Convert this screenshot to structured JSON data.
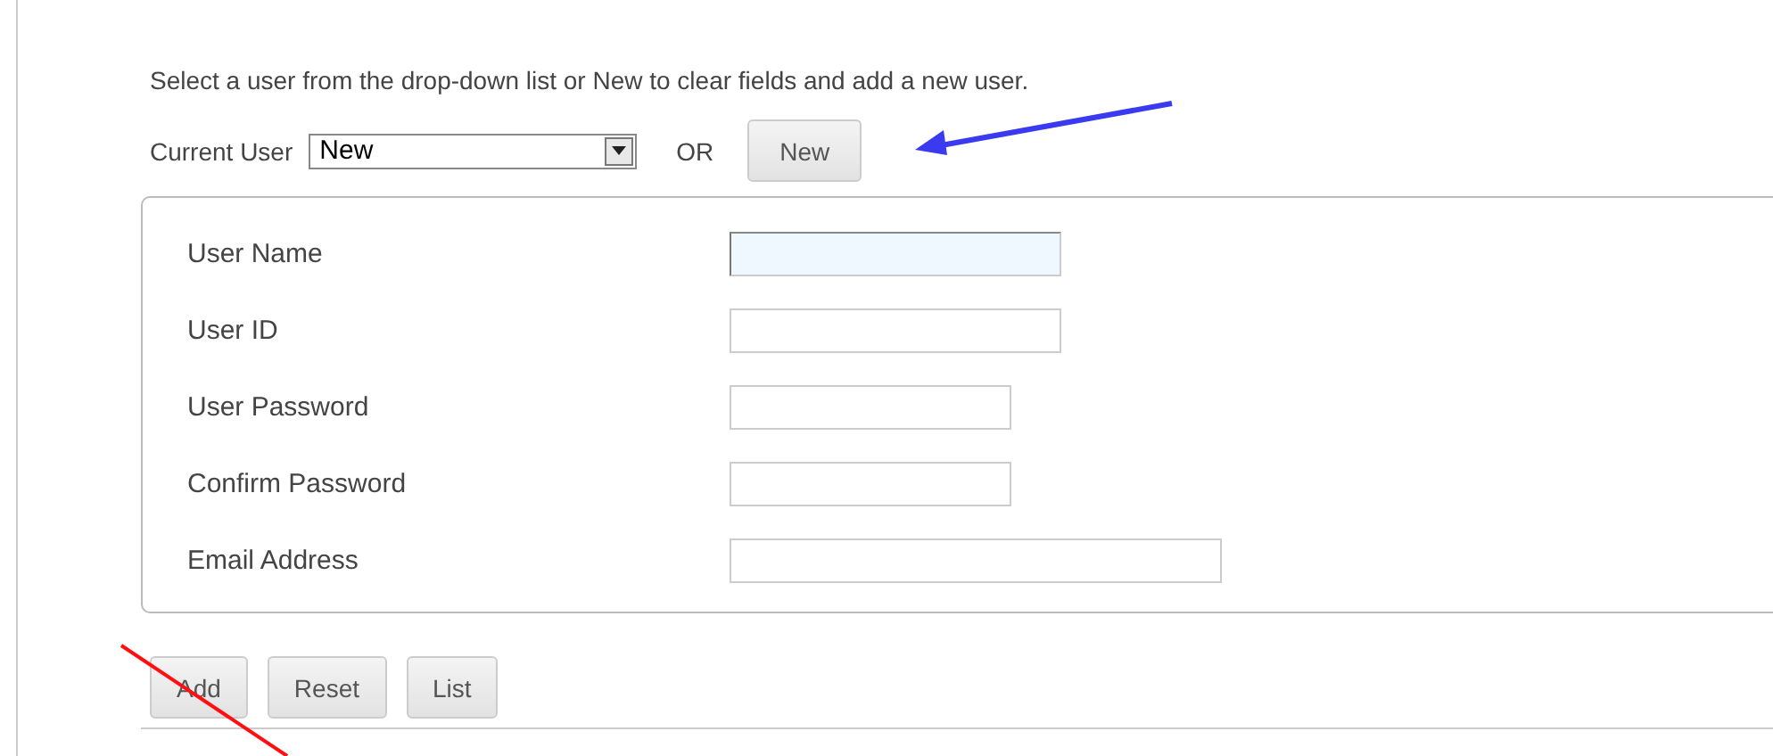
{
  "instruction": "Select a user from the drop-down list or New to clear fields and add a new user.",
  "current_user": {
    "label": "Current User",
    "value": "New",
    "or": "OR",
    "new_button": "New"
  },
  "fields": [
    {
      "label": "User Name",
      "kind": "medium",
      "focused": true
    },
    {
      "label": "User ID",
      "kind": "medium",
      "focused": false
    },
    {
      "label": "User Password",
      "kind": "short",
      "focused": false
    },
    {
      "label": "Confirm Password",
      "kind": "short",
      "focused": false
    },
    {
      "label": "Email Address",
      "kind": "long",
      "focused": false
    }
  ],
  "buttons": [
    "Add",
    "Reset",
    "List"
  ],
  "annotations": {
    "arrow": {
      "color": "#3a3af0"
    },
    "line": {
      "color": "#ff1010"
    }
  }
}
